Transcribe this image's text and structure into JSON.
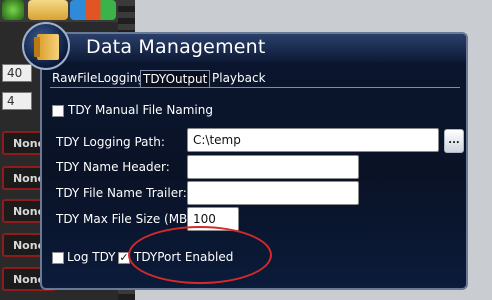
{
  "background_app": {
    "fields": [
      "40",
      "4"
    ],
    "none_buttons": [
      "None",
      "None",
      "None",
      "None",
      "None",
      "None"
    ]
  },
  "dialog": {
    "title": "Data Management",
    "tabs": [
      {
        "label": "RawFileLogging",
        "active": false
      },
      {
        "label": "TDYOutput",
        "active": true
      },
      {
        "label": "Playback",
        "active": false
      }
    ],
    "manual_naming": {
      "label": "TDY Manual File Naming",
      "checked": false
    },
    "logging_path": {
      "label": "TDY Logging Path:",
      "value": "C:\\temp",
      "browse_label": "..."
    },
    "name_header": {
      "label": "TDY Name Header:",
      "value": ""
    },
    "file_name_trailer": {
      "label": "TDY File Name Trailer:",
      "value": ""
    },
    "max_file_size": {
      "label": "TDY Max File Size (MB):",
      "value": "100"
    },
    "log_tdy": {
      "label": "Log TDY",
      "checked": false
    },
    "tdyport_enabled": {
      "label": "TDYPort Enabled",
      "checked": true,
      "check_glyph": "✓"
    }
  },
  "annotation": {
    "color": "#d62a2a"
  }
}
